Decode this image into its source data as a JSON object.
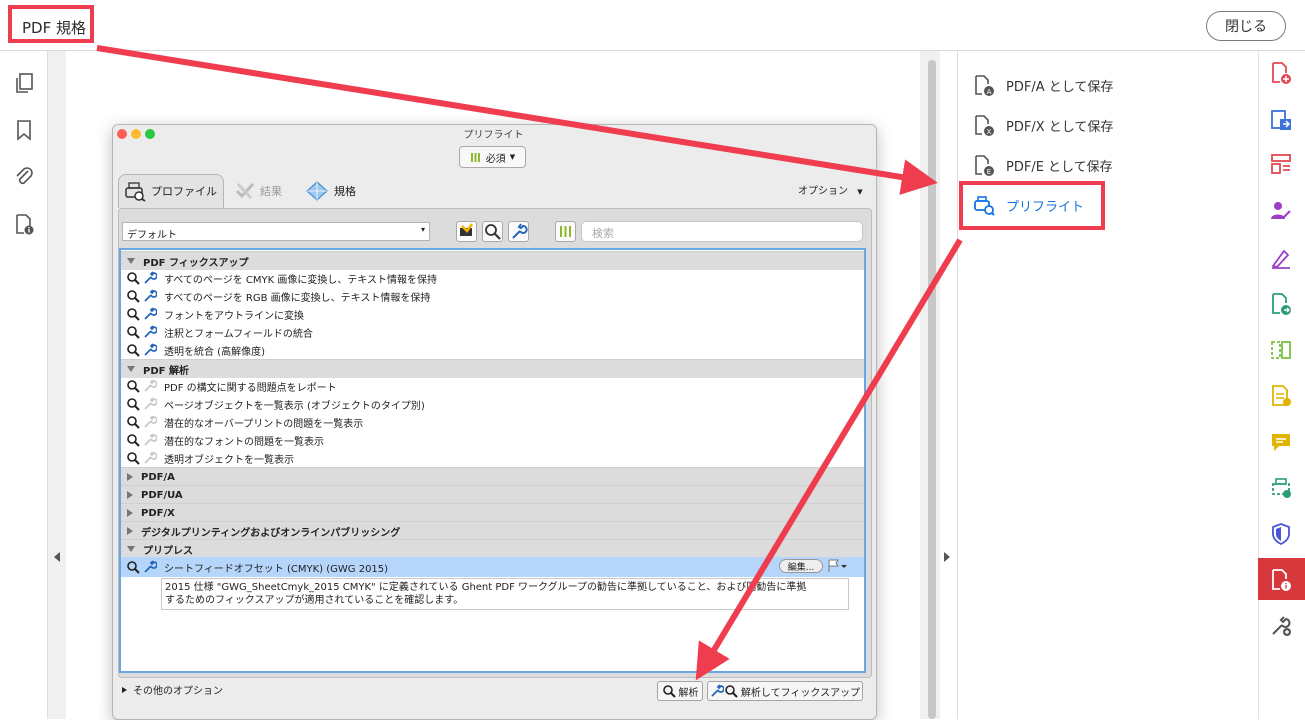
{
  "header": {
    "title": "PDF 規格",
    "close_label": "閉じる"
  },
  "left_rail": {
    "icons": [
      "pages-icon",
      "bookmark-icon",
      "attachment-icon",
      "document-info-icon"
    ]
  },
  "right_panel": {
    "items": [
      {
        "label": "PDF/A として保存"
      },
      {
        "label": "PDF/X として保存"
      },
      {
        "label": "PDF/E として保存"
      },
      {
        "label": "プリフライト"
      }
    ]
  },
  "dialog": {
    "title": "プリフライト",
    "required_label": "必須",
    "tabs": [
      {
        "label": "プロファイル"
      },
      {
        "label": "結果"
      },
      {
        "label": "規格"
      }
    ],
    "options_label": "オプション",
    "profile_select": "デフォルト",
    "search_placeholder": "検索",
    "groups": {
      "fixups": {
        "label": "PDF フィックスアップ",
        "items": [
          "すべてのページを CMYK 画像に変換し、テキスト情報を保持",
          "すべてのページを RGB 画像に変換し、テキスト情報を保持",
          "フォントをアウトラインに変換",
          "注釈とフォームフィールドの統合",
          "透明を統合 (高解像度)"
        ]
      },
      "analysis": {
        "label": "PDF 解析",
        "items": [
          "PDF の構文に関する問題点をレポート",
          "ページオブジェクトを一覧表示 (オブジェクトのタイプ別)",
          "潜在的なオーバープリントの問題を一覧表示",
          "潜在的なフォントの問題を一覧表示",
          "透明オブジェクトを一覧表示"
        ]
      },
      "pdfa": {
        "label": "PDF/A"
      },
      "pdfua": {
        "label": "PDF/UA"
      },
      "pdfx": {
        "label": "PDF/X"
      },
      "digital": {
        "label": "デジタルプリンティングおよびオンラインパブリッシング"
      },
      "prepress": {
        "label": "プリプレス",
        "selected_item": "シートフィードオフセット (CMYK) (GWG 2015)",
        "edit_label": "編集...",
        "description_line1": "2015 仕様 \"GWG_SheetCmyk_2015 CMYK\" に定義されている Ghent PDF ワークグループの勧告に準拠していること、および同勧告に準拠",
        "description_line2": "するためのフィックスアップが適用されていることを確認します。"
      }
    },
    "more_options_label": "その他のオプション",
    "analyze_label": "解析",
    "analyze_fix_label": "解析してフィックスアップ"
  },
  "colors": {
    "highlight_red": "#ef3c4f",
    "accent_blue": "#1473e6",
    "active_tool": "#d7383b"
  }
}
